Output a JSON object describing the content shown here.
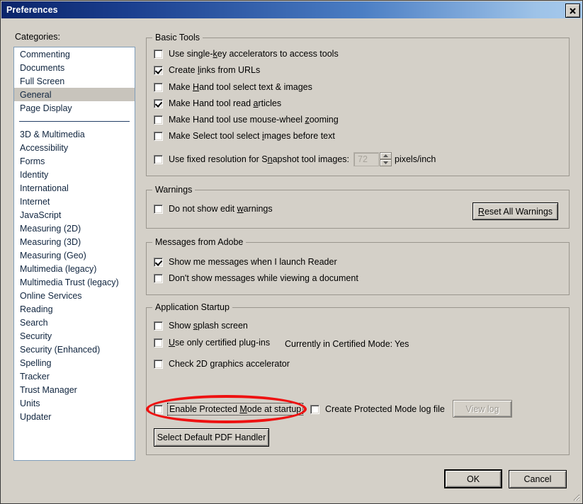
{
  "window": {
    "title": "Preferences",
    "close_icon": "close-icon",
    "close_glyph": "✕"
  },
  "sidebar": {
    "label": "Categories:",
    "selected": "General",
    "items_top": [
      {
        "label": "Commenting"
      },
      {
        "label": "Documents"
      },
      {
        "label": "Full Screen"
      },
      {
        "label": "General"
      },
      {
        "label": "Page Display"
      }
    ],
    "items_bottom": [
      {
        "label": "3D & Multimedia"
      },
      {
        "label": "Accessibility"
      },
      {
        "label": "Forms"
      },
      {
        "label": "Identity"
      },
      {
        "label": "International"
      },
      {
        "label": "Internet"
      },
      {
        "label": "JavaScript"
      },
      {
        "label": "Measuring (2D)"
      },
      {
        "label": "Measuring (3D)"
      },
      {
        "label": "Measuring (Geo)"
      },
      {
        "label": "Multimedia (legacy)"
      },
      {
        "label": "Multimedia Trust (legacy)"
      },
      {
        "label": "Online Services"
      },
      {
        "label": "Reading"
      },
      {
        "label": "Search"
      },
      {
        "label": "Security"
      },
      {
        "label": "Security (Enhanced)"
      },
      {
        "label": "Spelling"
      },
      {
        "label": "Tracker"
      },
      {
        "label": "Trust Manager"
      },
      {
        "label": "Units"
      },
      {
        "label": "Updater"
      }
    ]
  },
  "basic_tools": {
    "title": "Basic Tools",
    "checks": [
      {
        "id": "single-key-accelerators",
        "pre": "Use single-",
        "accel": "k",
        "post": "ey accelerators to access tools",
        "checked": false
      },
      {
        "id": "create-links-from-urls",
        "pre": "Create ",
        "accel": "l",
        "post": "inks from URLs",
        "checked": true
      },
      {
        "id": "hand-tool-select-text-images",
        "pre": "Make ",
        "accel": "H",
        "post": "and tool select text & images",
        "checked": false
      },
      {
        "id": "hand-tool-read-articles",
        "pre": "Make Hand tool read ",
        "accel": "a",
        "post": "rticles",
        "checked": true
      },
      {
        "id": "hand-tool-mouse-wheel-zoom",
        "pre": "Make Hand tool use mouse-wheel ",
        "accel": "z",
        "post": "ooming",
        "checked": false
      },
      {
        "id": "select-tool-images-before-text",
        "pre": "Make Select tool select ",
        "accel": "i",
        "post": "mages before text",
        "checked": false
      },
      {
        "id": "fixed-resolution-snapshot",
        "pre": "Use fixed resolution for S",
        "accel": "n",
        "post": "apshot tool images:",
        "checked": false
      }
    ],
    "resolution_value": "72",
    "resolution_units": "pixels/inch"
  },
  "warnings": {
    "title": "Warnings",
    "check": {
      "id": "do-not-show-edit-warnings",
      "pre": "Do not show edit ",
      "accel": "w",
      "post": "arnings",
      "checked": false
    },
    "reset_button": {
      "pre": "",
      "accel": "R",
      "post": "eset All Warnings"
    }
  },
  "messages_from_adobe": {
    "title": "Messages from Adobe",
    "checks": [
      {
        "id": "show-messages-on-launch",
        "pre": "Show me messages when I launch Reader",
        "accel": "",
        "post": "",
        "checked": true
      },
      {
        "id": "dont-show-messages-while-viewing",
        "pre": "Don't show messages while viewing a document",
        "accel": "",
        "post": "",
        "checked": false
      }
    ]
  },
  "application_startup": {
    "title": "Application Startup",
    "checks": [
      {
        "id": "show-splash-screen",
        "pre": "Show ",
        "accel": "s",
        "post": "plash screen",
        "checked": false
      },
      {
        "id": "use-only-certified-plugins",
        "pre": "",
        "accel": "U",
        "post": "se only certified plug-ins",
        "checked": false
      },
      {
        "id": "check-2d-graphics-accelerator",
        "pre": "Check 2D ",
        "accel": "g",
        "post": "raphics accelerator",
        "checked": false
      }
    ],
    "certified_mode_label": "Currently in Certified Mode:",
    "certified_mode_value": "Yes",
    "protected_mode": {
      "id": "enable-protected-mode",
      "pre": "Enable Protected ",
      "accel": "M",
      "post": "ode at startup",
      "checked": false,
      "focused": true,
      "highlighted": true
    },
    "log_file": {
      "id": "create-protected-mode-log",
      "pre": "Create Protected Mode log file",
      "accel": "",
      "post": "",
      "checked": false
    },
    "view_log_button": {
      "label": "View log",
      "disabled": true
    },
    "pdf_handler_button": {
      "label": "Select Default PDF Handler"
    }
  },
  "footer": {
    "ok_button": "OK",
    "cancel_button": "Cancel"
  },
  "highlight_color": "#ee1111"
}
